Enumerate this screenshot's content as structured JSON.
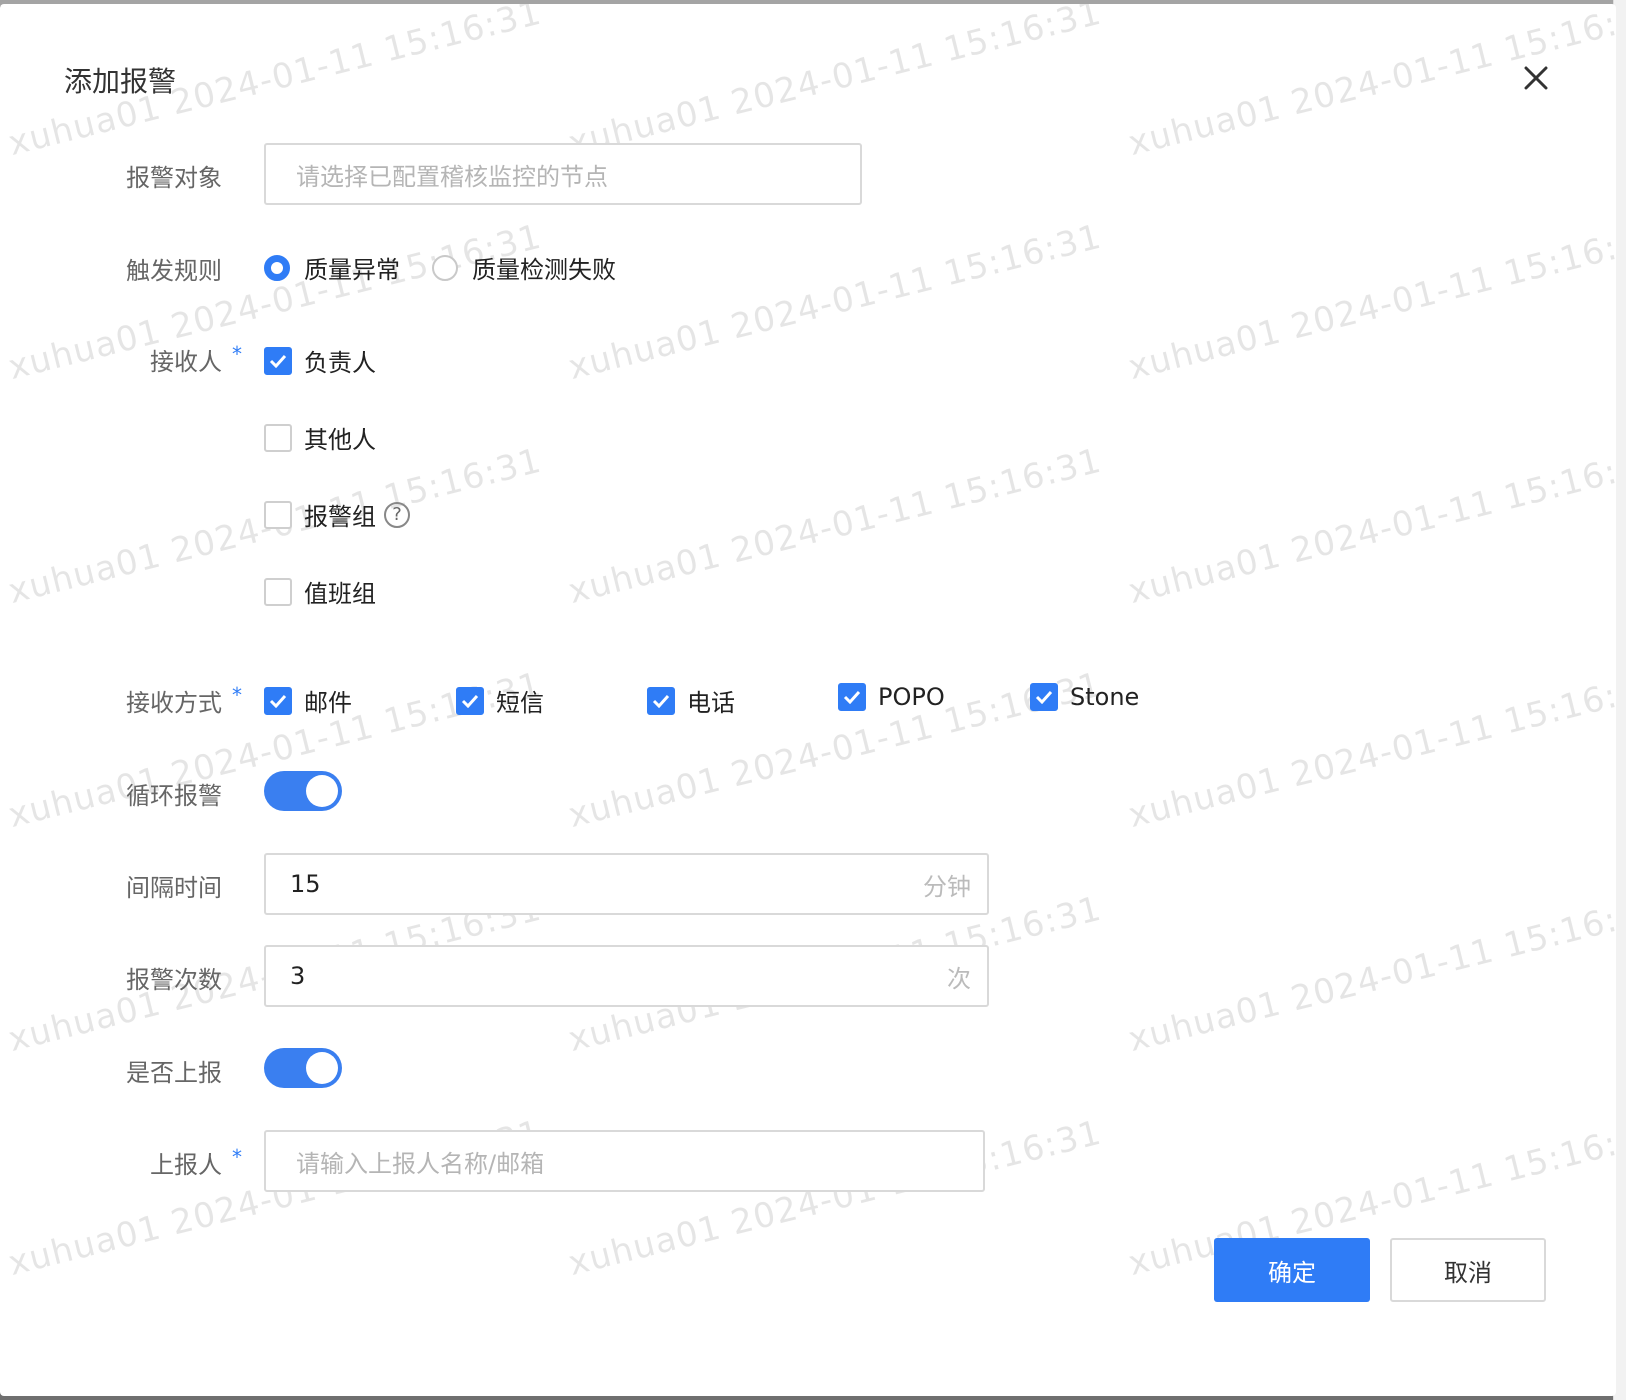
{
  "dialog": {
    "title": "添加报警",
    "watermark_text": "xuhua01 2024-01-11 15:16:31"
  },
  "form": {
    "target": {
      "label": "报警对象",
      "placeholder": "请选择已配置稽核监控的节点"
    },
    "trigger": {
      "label": "触发规则",
      "options": [
        {
          "label": "质量异常",
          "selected": true
        },
        {
          "label": "质量检测失败",
          "selected": false
        }
      ]
    },
    "receivers": {
      "label": "接收人",
      "required_mark": "*",
      "options": [
        {
          "label": "负责人",
          "checked": true
        },
        {
          "label": "其他人",
          "checked": false
        },
        {
          "label": "报警组",
          "checked": false,
          "help": "?"
        },
        {
          "label": "值班组",
          "checked": false
        }
      ]
    },
    "methods": {
      "label": "接收方式",
      "required_mark": "*",
      "options": [
        {
          "label": "邮件",
          "checked": true
        },
        {
          "label": "短信",
          "checked": true
        },
        {
          "label": "电话",
          "checked": true
        },
        {
          "label": "POPO",
          "checked": true
        },
        {
          "label": "Stone",
          "checked": true
        }
      ]
    },
    "loop_alarm": {
      "label": "循环报警",
      "on": true
    },
    "interval": {
      "label": "间隔时间",
      "value": "15",
      "unit": "分钟"
    },
    "count": {
      "label": "报警次数",
      "value": "3",
      "unit": "次"
    },
    "report": {
      "label": "是否上报",
      "on": true
    },
    "reporter": {
      "label": "上报人",
      "required_mark": "*",
      "placeholder": "请输入上报人名称/邮箱"
    }
  },
  "footer": {
    "confirm_label": "确定",
    "cancel_label": "取消"
  },
  "colors": {
    "accent": "#2f7cf6",
    "label": "#666666",
    "border": "#d9d9d9"
  }
}
